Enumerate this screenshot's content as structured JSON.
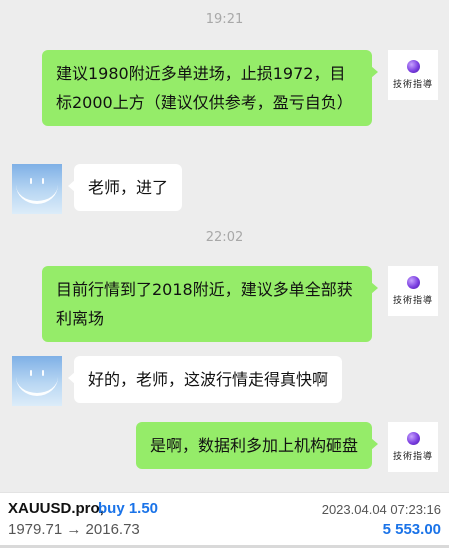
{
  "chat": {
    "timestamps": [
      "19:21",
      "22:02"
    ],
    "brand_text": "技術指導",
    "messages": [
      {
        "side": "right",
        "text": "建议1980附近多单进场，止损1972，目标2000上方（建议仅供参考，盈亏自负）"
      },
      {
        "side": "left",
        "text": "老师，进了"
      },
      {
        "side": "right",
        "text": "目前行情到了2018附近，建议多单全部获利离场"
      },
      {
        "side": "left",
        "text": "好的，老师，这波行情走得真快啊"
      },
      {
        "side": "right",
        "text": "是啊，数据利多加上机构砸盘"
      }
    ]
  },
  "trade": {
    "symbol": "XAUUSD.pro,",
    "side": "buy 1.50",
    "datetime": "2023.04.04 07:23:16",
    "prices": "1979.71 → 2016.73",
    "profit": "5 553.00",
    "colors": {
      "side": "#1a73e8",
      "profit": "#1a73e8"
    }
  },
  "colors": {
    "bubble_out": "#95ec69",
    "bubble_in": "#ffffff",
    "background": "#ededed"
  }
}
